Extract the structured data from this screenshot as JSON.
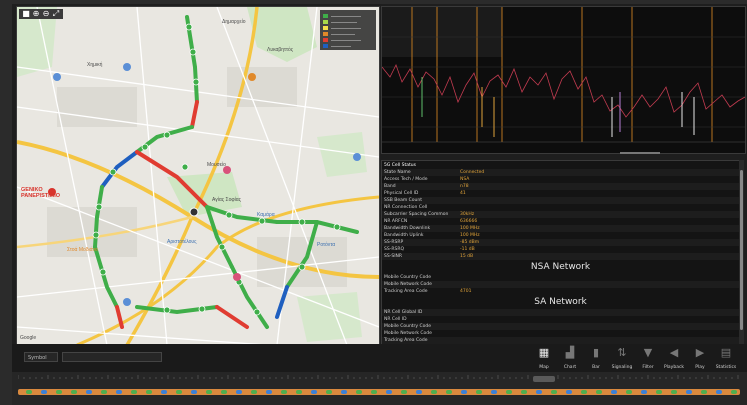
{
  "map": {
    "toolbar_icons": [
      "square-icon",
      "zoom-in-icon",
      "zoom-out-icon",
      "fullscreen-icon"
    ],
    "labels": [
      {
        "text": "Δημαρχείο",
        "cls": "dark"
      },
      {
        "text": "Λυκαβηττός",
        "cls": "dark"
      },
      {
        "text": "Χημική",
        "cls": "dark"
      },
      {
        "text": "GENIKO PANEPISTIMIO",
        "cls": "red"
      },
      {
        "text": "Μουσείο",
        "cls": "dark"
      },
      {
        "text": "Αγίας Σοφίας",
        "cls": "dark"
      },
      {
        "text": "Αριστοτέλους",
        "cls": "blue"
      },
      {
        "text": "Στοά Μοδιάνο",
        "cls": "orange"
      },
      {
        "text": "Καμάρα",
        "cls": "blue"
      },
      {
        "text": "Ροτόντα",
        "cls": "blue"
      }
    ],
    "google_label": "Google"
  },
  "chart": {
    "title": "",
    "x_labels": [
      "",
      "",
      "",
      ""
    ]
  },
  "info": {
    "rows_top": [
      {
        "k": "5G Cell Status",
        "v": "",
        "hdr": true
      },
      {
        "k": "State Name",
        "v": "Connected"
      },
      {
        "k": "Access Tech / Mode",
        "v": "NSA"
      },
      {
        "k": "Band",
        "v": "n78"
      },
      {
        "k": "Physical Cell ID",
        "v": "41"
      },
      {
        "k": "SSB Beam Count",
        "v": ""
      },
      {
        "k": "NR Connection Cell",
        "v": ""
      },
      {
        "k": "Subcarrier Spacing Common",
        "v": "30kHz"
      },
      {
        "k": "NR ARFCN",
        "v": "636666"
      },
      {
        "k": "Bandwidth Downlink",
        "v": "100 MHz"
      },
      {
        "k": "Bandwidth Uplink",
        "v": "100 MHz"
      },
      {
        "k": "SS-RSRP",
        "v": "-85 dBm"
      },
      {
        "k": "SS-RSRQ",
        "v": "-11 dB"
      },
      {
        "k": "SS-SINR",
        "v": "15 dB"
      }
    ],
    "nsa_title": "NSA Network",
    "rows_mid": [
      {
        "k": "Mobile Country Code",
        "v": ""
      },
      {
        "k": "Mobile Network Code",
        "v": ""
      },
      {
        "k": "Tracking Area Code",
        "v": "4701"
      }
    ],
    "sa_title": "SA Network",
    "rows_bottom": [
      {
        "k": "NR Cell Global ID",
        "v": ""
      },
      {
        "k": "NR Cell ID",
        "v": ""
      },
      {
        "k": "Mobile Country Code",
        "v": ""
      },
      {
        "k": "Mobile Network Code",
        "v": ""
      },
      {
        "k": "Tracking Area Code",
        "v": ""
      }
    ]
  },
  "bottombar": {
    "select1": "Symbol",
    "select2": "",
    "tools": [
      {
        "label": "Map",
        "icon": "map-icon"
      },
      {
        "label": "Chart",
        "icon": "chart-icon"
      },
      {
        "label": "Bar",
        "icon": "bar-chart-icon"
      },
      {
        "label": "Signaling",
        "icon": "signal-icon"
      },
      {
        "label": "Filter",
        "icon": "filter-icon"
      },
      {
        "label": "Playback",
        "icon": "playback-icon"
      },
      {
        "label": "Play",
        "icon": "play-icon"
      },
      {
        "label": "Statistics",
        "icon": "statistics-icon"
      }
    ]
  },
  "timeline": {
    "handle_label": "",
    "tick_labels": [
      "",
      "",
      "",
      ""
    ]
  }
}
